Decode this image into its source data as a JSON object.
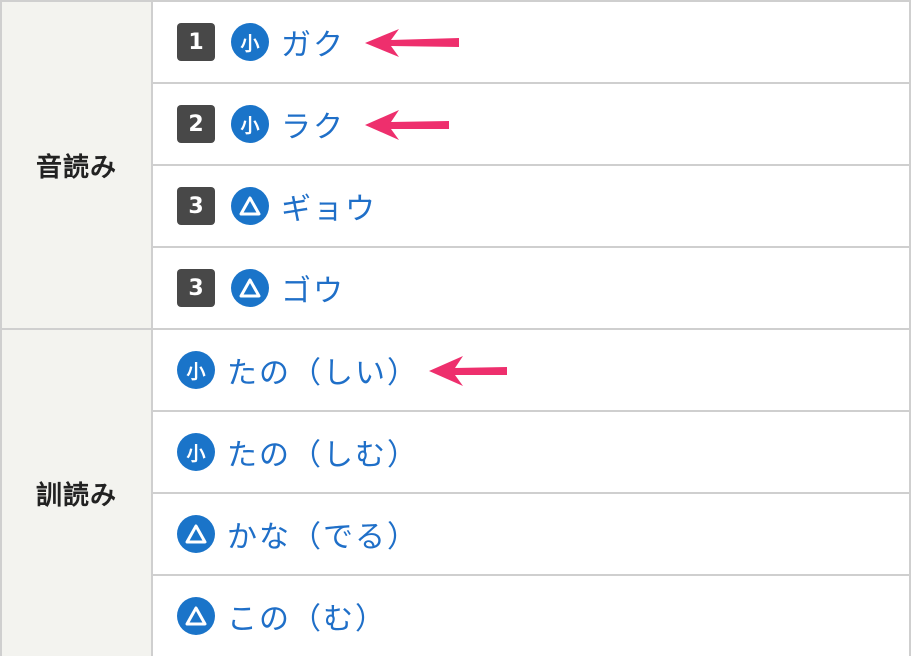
{
  "on_yomi": {
    "label": "音読み",
    "rows": [
      {
        "grade": "1",
        "level_icon": "small-icon",
        "level_text": "小",
        "reading": "ガク",
        "arrow": true
      },
      {
        "grade": "2",
        "level_icon": "small-icon",
        "level_text": "小",
        "reading": "ラク",
        "arrow": true
      },
      {
        "grade": "3",
        "level_icon": "triangle-icon",
        "level_text": "",
        "reading": "ギョウ",
        "arrow": false
      },
      {
        "grade": "3",
        "level_icon": "triangle-icon",
        "level_text": "",
        "reading": "ゴウ",
        "arrow": false
      }
    ]
  },
  "kun_yomi": {
    "label": "訓読み",
    "rows": [
      {
        "level_icon": "small-icon",
        "level_text": "小",
        "reading": "たの（しい）",
        "arrow": true
      },
      {
        "level_icon": "small-icon",
        "level_text": "小",
        "reading": "たの（しむ）",
        "arrow": false
      },
      {
        "level_icon": "triangle-icon",
        "level_text": "",
        "reading": "かな（でる）",
        "arrow": false
      },
      {
        "level_icon": "triangle-icon",
        "level_text": "",
        "reading": "この（む）",
        "arrow": false
      }
    ]
  },
  "colors": {
    "reading": "#1f6fc8",
    "badge_blue": "#1a74c9",
    "grade_box": "#484848",
    "arrow": "#ee2f6d",
    "header_bg": "#f3f3ef",
    "border": "#cfcfcf"
  }
}
